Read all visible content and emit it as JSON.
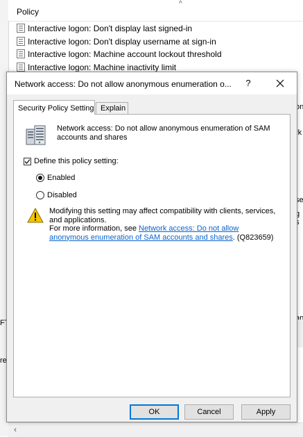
{
  "background": {
    "column_header": "Policy",
    "sort_arrow": "^",
    "rows": [
      "Interactive logon: Don't display last signed-in",
      "Interactive logon: Don't display username at sign-in",
      "Interactive logon: Machine account lockout threshold",
      "Interactive logon: Machine inactivity limit"
    ],
    "right_fragments": [
      "on",
      "rk",
      "se",
      "g s",
      "an"
    ],
    "left_fragments": [
      "FT",
      "red"
    ]
  },
  "dialog": {
    "title": "Network access: Do not allow anonymous enumeration o...",
    "help_label": "?",
    "tabs": [
      "Security Policy Setting",
      "Explain"
    ],
    "policy_name": "Network access: Do not allow anonymous enumeration of SAM accounts and shares",
    "define_label": "Define this policy setting:",
    "define_checked": true,
    "options": [
      {
        "label": "Enabled",
        "selected": true
      },
      {
        "label": "Disabled",
        "selected": false
      }
    ],
    "warning_text": "Modifying this setting may affect compatibility with clients, services, and applications.",
    "more_info_prefix": "For more information, see ",
    "more_info_link": "Network access: Do not allow anonymous enumeration of SAM accounts and shares",
    "more_info_suffix": ". (Q823659)",
    "buttons": {
      "ok": "OK",
      "cancel": "Cancel",
      "apply": "Apply"
    }
  },
  "colors": {
    "link": "#0a63c9",
    "focus": "#0078d7"
  }
}
